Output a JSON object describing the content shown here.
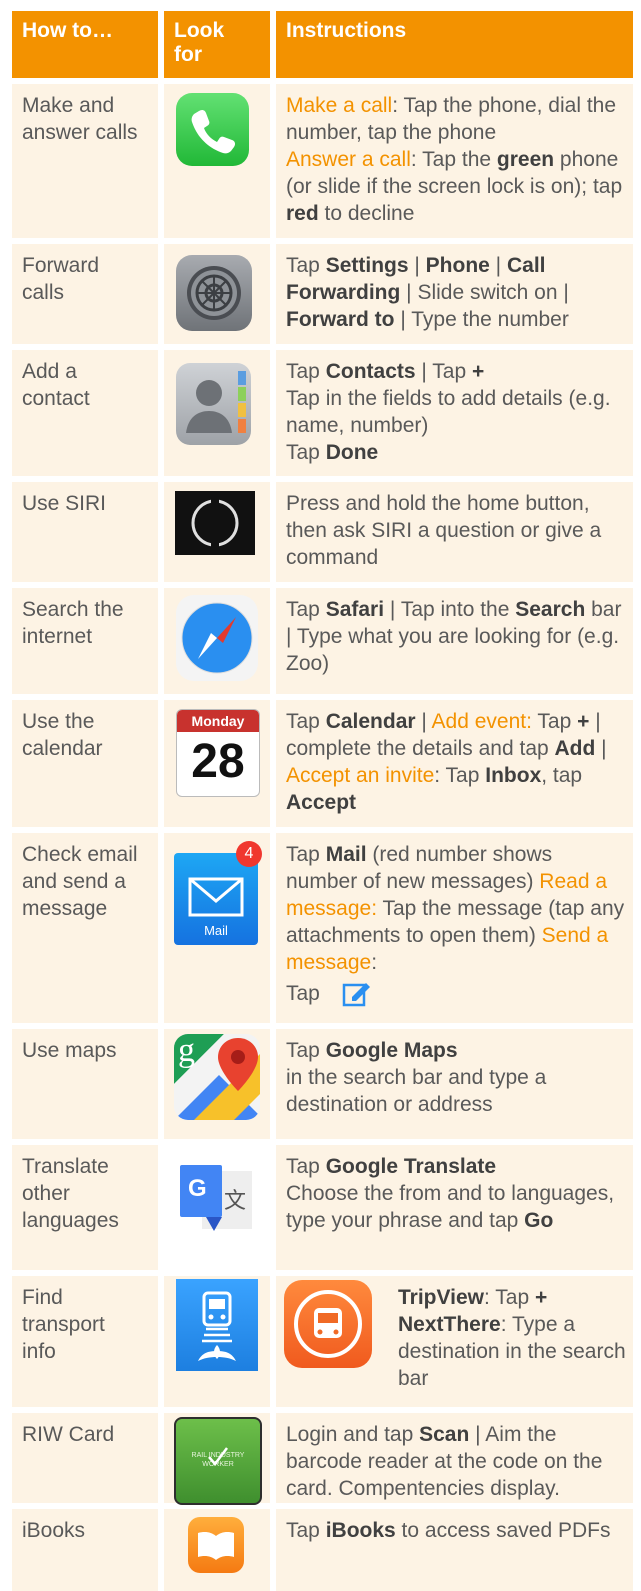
{
  "header": {
    "col1": "How to…",
    "col2": "Look for",
    "col3": "Instructions"
  },
  "colors": {
    "accent": "#f39200",
    "cell_bg": "#fdf3e4",
    "text": "#595959"
  },
  "rows": [
    {
      "task": "Make and answer calls",
      "icon": "phone-app-icon",
      "seg": [
        "Make a call",
        ": Tap the phone, dial the number, tap the phone ",
        "Answer a call",
        ": Tap the ",
        "green",
        " phone (or slide if the screen lock is on); tap ",
        "red",
        " to decline"
      ]
    },
    {
      "task": "Forward calls",
      "icon": "settings-app-icon",
      "seg": [
        "Tap ",
        "Settings",
        " | ",
        "Phone",
        " | ",
        "Call Forwarding",
        " | Slide switch on | ",
        "Forward to",
        " | Type the number"
      ]
    },
    {
      "task": "Add a contact",
      "icon": "contacts-app-icon",
      "seg": [
        "Tap ",
        "Contacts",
        " | Tap ",
        "+",
        "Tap in the fields to add details (e.g. name, number)",
        "Tap ",
        "Done"
      ]
    },
    {
      "task": "Use SIRI",
      "icon": "siri-icon",
      "seg": [
        "Press and hold the home button, then ask SIRI a question or give a command"
      ]
    },
    {
      "task": "Search the internet",
      "icon": "safari-app-icon",
      "seg": [
        "Tap ",
        "Safari",
        " | Tap into the ",
        "Search",
        " bar | Type what you are looking for (e.g. Zoo)"
      ]
    },
    {
      "task": "Use the calendar",
      "icon": "calendar-app-icon",
      "calendar_day": "Monday",
      "calendar_date": "28",
      "seg": [
        "Tap ",
        "Calendar",
        " | ",
        "Add event:",
        " Tap ",
        "+",
        " | complete the details and tap ",
        "Add",
        " | ",
        "Accept an invite",
        ": Tap ",
        "Inbox",
        ", tap ",
        "Accept"
      ]
    },
    {
      "task": "Check email and send a message",
      "icon": "mail-app-icon",
      "mail_badge": "4",
      "mail_label": "Mail",
      "seg": [
        "Tap ",
        "Mail",
        " (red number shows number of new messages) ",
        "Read a message:",
        " Tap the message (tap any attachments to open them) ",
        "Send a message",
        ":",
        "Tap "
      ]
    },
    {
      "task": "Use maps",
      "icon": "google-maps-icon",
      "maps_letter": "g",
      "seg": [
        "Tap ",
        "Google Maps",
        "in the search bar and type a destination or address"
      ]
    },
    {
      "task": "Translate other languages",
      "icon": "google-translate-icon",
      "translate_letter": "G",
      "translate_glyph": "文",
      "seg": [
        "Tap ",
        "Google Translate",
        "Choose the from and to languages, type your phrase and tap ",
        "Go"
      ]
    },
    {
      "task": "Find transport info",
      "icon": "tripview-app-icon",
      "seg": [
        "TripView",
        ": Tap ",
        "+",
        "NextThere",
        ": Type a destination in the search bar"
      ]
    },
    {
      "task": "RIW Card",
      "icon": "riw-card-icon",
      "riw_text": "RAIL INDUSTRY WORKER",
      "seg": [
        "Login and tap ",
        "Scan",
        " | Aim the barcode reader at the code on the card. Compentencies display."
      ]
    },
    {
      "task": "iBooks",
      "icon": "ibooks-app-icon",
      "seg": [
        "Tap ",
        "iBooks",
        " to access saved PDFs"
      ]
    }
  ]
}
